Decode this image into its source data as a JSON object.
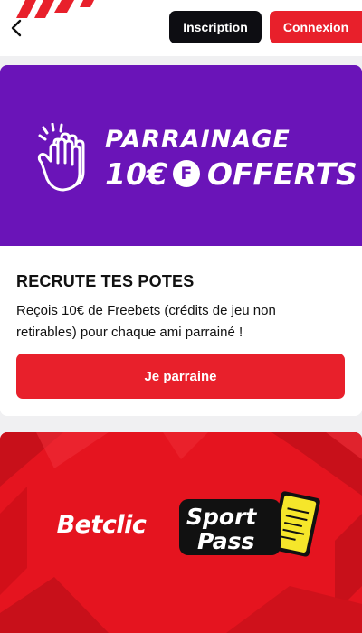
{
  "header": {
    "back_icon": "chevron-left-icon",
    "signup_label": "Inscription",
    "login_label": "Connexion"
  },
  "promo": {
    "banner": {
      "line1": "PARRAINAGE",
      "amount": "10€",
      "coin_letter": "F",
      "offered": "OFFERTS",
      "icon": "high-five-hands-icon"
    },
    "title": "RECRUTE TES POTES",
    "description": "Reçois 10€ de Freebets (crédits de jeu non retirables) pour chaque ami parrainé !",
    "cta_label": "Je parraine"
  },
  "sport_pass": {
    "betclic_logo_text": "Betclic",
    "sportpass_line1": "Sport",
    "sportpass_line2": "Pass"
  },
  "colors": {
    "brand_red": "#e8202b",
    "banner_purple": "#6a14b8",
    "dark_button": "#0d0d12",
    "pass_yellow": "#f5e62a"
  }
}
